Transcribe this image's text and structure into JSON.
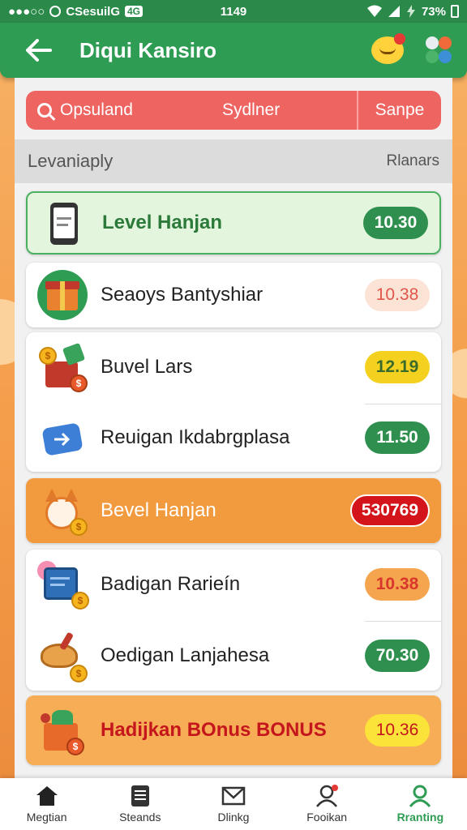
{
  "status_bar": {
    "left_text": "●●●○○",
    "carrier": "CSesuilG",
    "network_badge": "4G",
    "time": "1149",
    "battery": "73%"
  },
  "app_bar": {
    "title": "Diqui Kansiro"
  },
  "filter_bar": {
    "search_label": "Opsuland",
    "middle_label": "Sydlner",
    "right_label": "Sanpe"
  },
  "list_header": {
    "left": "Levaniaply",
    "right": "Rlanars"
  },
  "rows": [
    {
      "name": "Level Hanjan",
      "value": "10.30"
    },
    {
      "name": "Seaoys Bantyshiar",
      "value": "10.38"
    },
    {
      "name": "Buvel Lars",
      "value": "12.19"
    },
    {
      "name": "Reuigan Ikdabrgplasa",
      "value": "11.50"
    },
    {
      "name": "Bevel Hanjan",
      "value": "530769"
    },
    {
      "name": "Badigan Rarieín",
      "value": "10.38"
    },
    {
      "name": "Oedigan Lanjahesa",
      "value": "70.30"
    },
    {
      "name": "Hadijkan BOnus BONUS",
      "value": "10.36"
    }
  ],
  "bottom_nav": [
    {
      "label": "Megtian",
      "icon": "home-icon"
    },
    {
      "label": "Steands",
      "icon": "list-icon"
    },
    {
      "label": "Dlinkg",
      "icon": "mail-icon"
    },
    {
      "label": "Fooikan",
      "icon": "user-icon"
    },
    {
      "label": "Rranting",
      "icon": "profile-icon"
    }
  ],
  "colors": {
    "brand_green": "#2f9c54",
    "filter_red": "#ee6461",
    "highlight_orange": "#f29a3e"
  }
}
